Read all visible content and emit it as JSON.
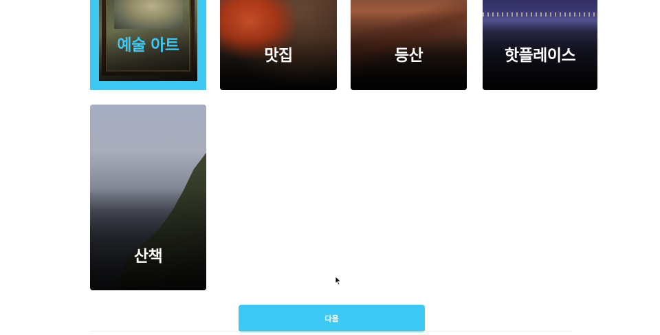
{
  "categories": [
    {
      "id": "art",
      "label": "예술 아트",
      "selected": true
    },
    {
      "id": "food",
      "label": "맛집",
      "selected": false
    },
    {
      "id": "hiking",
      "label": "등산",
      "selected": false
    },
    {
      "id": "hotplace",
      "label": "핫플레이스",
      "selected": false
    },
    {
      "id": "walk",
      "label": "산책",
      "selected": false
    }
  ],
  "next_button": {
    "label": "다음"
  },
  "colors": {
    "accent": "#3ec9f5",
    "text_on_image": "#ffffff"
  }
}
